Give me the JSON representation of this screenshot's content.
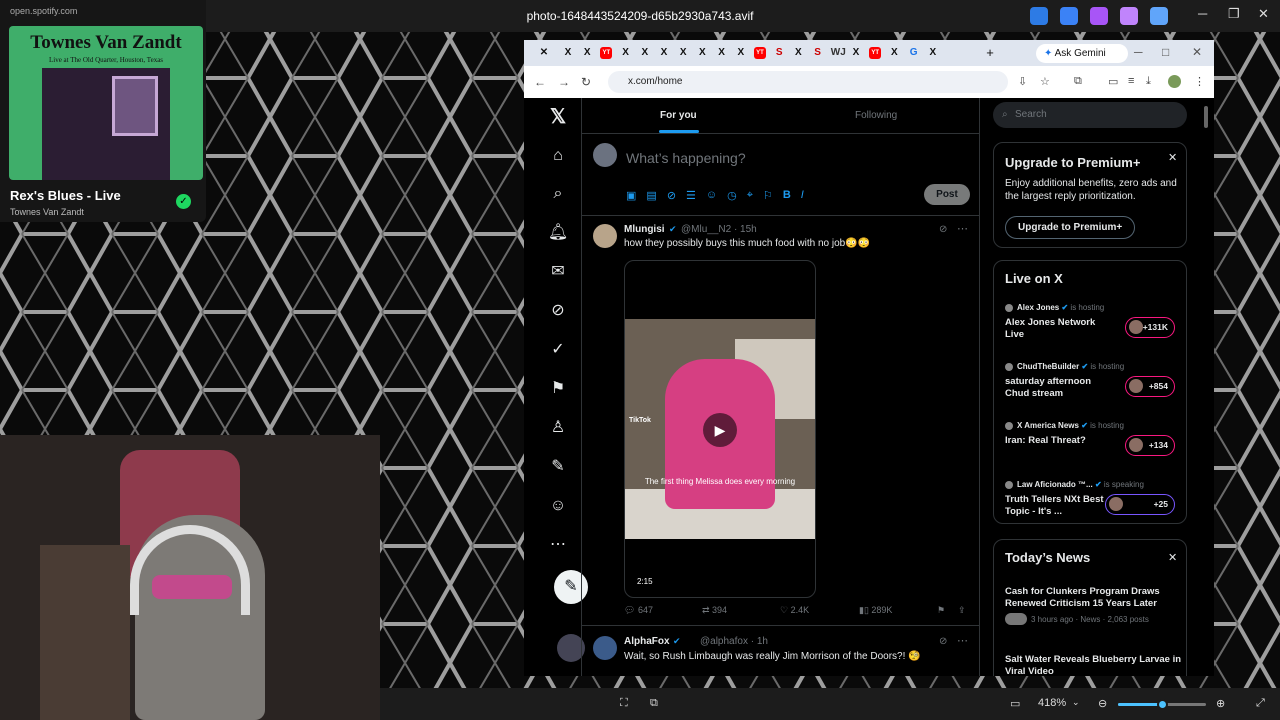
{
  "viewer": {
    "title": "photo-1648443524209-d65b2930a743.avif",
    "zoom": "418%",
    "zoom_fraction": 0.5
  },
  "spotify": {
    "url": "open.spotify.com",
    "album_title": "Townes Van Zandt",
    "album_subtitle": "Live at The Old Quarter, Houston, Texas",
    "song": "Rex's Blues - Live",
    "artist": "Townes Van Zandt",
    "accent": "#1ed760"
  },
  "browser": {
    "tabs": [
      "X",
      "X",
      "YT",
      "X",
      "X",
      "X",
      "X",
      "X",
      "X",
      "X",
      "YT",
      "S",
      "X",
      "S",
      "WJ",
      "X",
      "YT",
      "X",
      "G",
      "X"
    ],
    "gemini": "Ask Gemini",
    "url": "x.com/home"
  },
  "x": {
    "feed_tabs": [
      "For you",
      "Following"
    ],
    "compose_placeholder": "What’s happening?",
    "post_button": "Post",
    "tweets": [
      {
        "name": "Mlungisi",
        "handle": "@Mlu__N2 · 15h",
        "text": "how they possibly buys this much food with no job😳😳",
        "video_watermark": "TikTok",
        "video_caption": "The first thing Melissa does every morning",
        "duration": "2:15",
        "replies": "647",
        "reposts": "394",
        "likes": "2.4K",
        "views": "289K"
      },
      {
        "name": "AlphaFox",
        "handle": "@alphafox · 1h",
        "text": "Wait, so Rush Limbaugh was really Jim Morrison of the Doors?! 🧐"
      }
    ],
    "search_placeholder": "Search",
    "premium": {
      "title": "Upgrade to Premium+",
      "desc": "Enjoy additional benefits, zero ads and the largest reply prioritization.",
      "button": "Upgrade to Premium+"
    },
    "live": {
      "title": "Live on X",
      "items": [
        {
          "host": "Alex Jones",
          "status": "is hosting",
          "title": "Alex Jones Network Live",
          "count": "+131K"
        },
        {
          "host": "ChudTheBuilder",
          "status": "is hosting",
          "title": "saturday afternoon Chud stream",
          "count": "+854"
        },
        {
          "host": "X America News",
          "status": "is hosting",
          "title": "Iran: Real Threat?",
          "count": "+134"
        },
        {
          "host": "Law Aficionado ™...",
          "status": "is speaking",
          "title": "Truth Tellers NXt Best Topic - It's ...",
          "count": "+25"
        }
      ]
    },
    "news": {
      "title": "Today’s News",
      "items": [
        {
          "title": "Cash for Clunkers Program Draws Renewed Criticism 15 Years Later",
          "meta": "3 hours ago · News · 2,063 posts"
        },
        {
          "title": "Salt Water Reveals Blueberry Larvae in Viral Video",
          "meta": ""
        }
      ]
    }
  }
}
